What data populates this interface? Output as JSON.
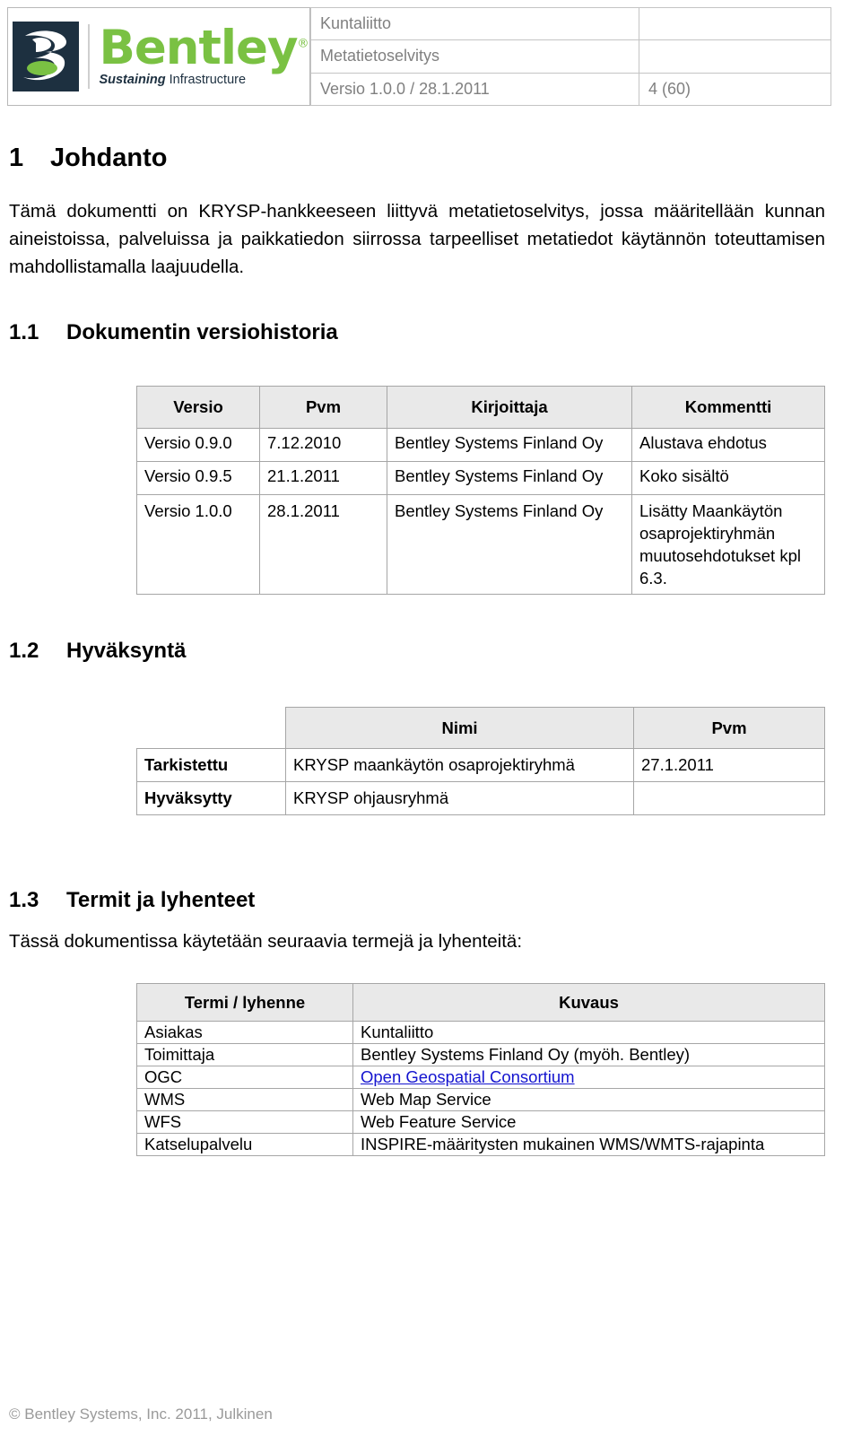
{
  "header": {
    "logo": {
      "word": "Bentley",
      "registered": "®",
      "tagline_bold": "Sustaining",
      "tagline_rest": " Infrastructure"
    },
    "rows": [
      {
        "label": "Kuntaliitto",
        "value": ""
      },
      {
        "label": "Metatietoselvitys",
        "value": ""
      },
      {
        "label": "Versio 1.0.0 / 28.1.2011",
        "value": "4 (60)"
      }
    ]
  },
  "sections": {
    "intro": {
      "number": "1",
      "title": "Johdanto",
      "paragraph": "Tämä dokumentti on KRYSP-hankkeeseen liittyvä metatietoselvitys, jossa määritellään kunnan aineistoissa, palveluissa ja paikkatiedon siirrossa tarpeelliset metatiedot käytännön toteuttamisen mahdollistamalla laajuudella."
    },
    "version_history": {
      "number": "1.1",
      "title": "Dokumentin versiohistoria"
    },
    "approval": {
      "number": "1.2",
      "title": "Hyväksyntä"
    },
    "terms": {
      "number": "1.3",
      "title": "Termit ja lyhenteet",
      "paragraph": "Tässä dokumentissa käytetään seuraavia termejä ja lyhenteitä:"
    }
  },
  "version_table": {
    "headers": [
      "Versio",
      "Pvm",
      "Kirjoittaja",
      "Kommentti"
    ],
    "rows": [
      {
        "versio": "Versio 0.9.0",
        "pvm": "7.12.2010",
        "kirjoittaja": "Bentley Systems Finland Oy",
        "kommentti": "Alustava ehdotus"
      },
      {
        "versio": "Versio 0.9.5",
        "pvm": "21.1.2011",
        "kirjoittaja": "Bentley Systems Finland Oy",
        "kommentti": "Koko sisältö"
      },
      {
        "versio": "Versio 1.0.0",
        "pvm": "28.1.2011",
        "kirjoittaja": "Bentley Systems Finland Oy",
        "kommentti": "Lisätty Maankäytön osaprojektiryhmän muutosehdotukset kpl 6.3."
      }
    ]
  },
  "approval_table": {
    "headers": [
      "",
      "Nimi",
      "Pvm"
    ],
    "rows": [
      {
        "label": "Tarkistettu",
        "nimi": "KRYSP maankäytön osaprojektiryhmä",
        "pvm": "27.1.2011"
      },
      {
        "label": "Hyväksytty",
        "nimi": "KRYSP ohjausryhmä",
        "pvm": ""
      }
    ]
  },
  "terms_table": {
    "headers": [
      "Termi / lyhenne",
      "Kuvaus"
    ],
    "rows": [
      {
        "term": "Asiakas",
        "desc": "Kuntaliitto",
        "is_link": false
      },
      {
        "term": "Toimittaja",
        "desc": "Bentley Systems Finland Oy (myöh. Bentley)",
        "is_link": false
      },
      {
        "term": "OGC",
        "desc": "Open Geospatial Consortium",
        "is_link": true
      },
      {
        "term": "WMS",
        "desc": "Web Map Service",
        "is_link": false
      },
      {
        "term": "WFS",
        "desc": "Web Feature Service",
        "is_link": false
      },
      {
        "term": "Katselupalvelu",
        "desc": "INSPIRE-määritysten mukainen WMS/WMTS-rajapinta",
        "is_link": false
      }
    ]
  },
  "footer": {
    "copyright": "© Bentley Systems, Inc. 2011, Julkinen"
  },
  "colors": {
    "brand_green": "#7ac143",
    "brand_navy": "#1d3040",
    "link_blue": "#1414cf",
    "table_header_bg": "#e9e9e9",
    "muted_text": "#808080"
  }
}
